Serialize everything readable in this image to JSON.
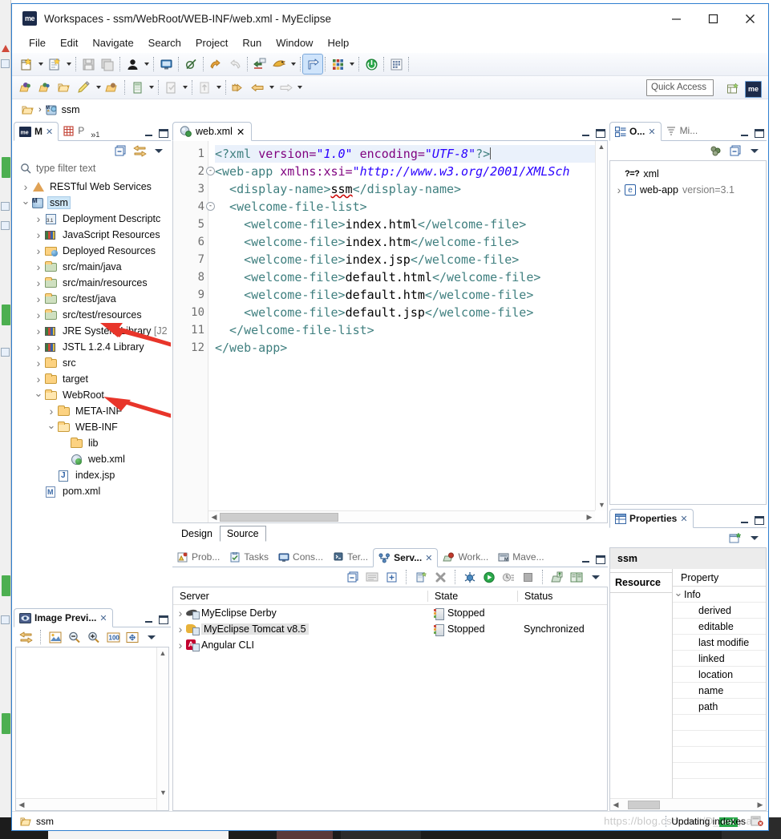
{
  "window": {
    "title": "Workspaces - ssm/WebRoot/WEB-INF/web.xml - MyEclipse",
    "logo_text": "me",
    "minimize": "—",
    "maximize": "☐",
    "close": "✕"
  },
  "menu": {
    "items": [
      {
        "label": "File"
      },
      {
        "label": "Edit"
      },
      {
        "label": "Navigate"
      },
      {
        "label": "Search"
      },
      {
        "label": "Project"
      },
      {
        "label": "Run"
      },
      {
        "label": "Window"
      },
      {
        "label": "Help"
      }
    ]
  },
  "toolbar": {
    "quick_access_placeholder": "Quick Access",
    "perspective_label": "me"
  },
  "breadcrumb": {
    "root_icon": "folder-icon",
    "separator": "›",
    "project": "ssm"
  },
  "explorer": {
    "tabs": [
      {
        "label": "M",
        "selected": true,
        "icon": "myeclipse-icon",
        "closeable": true
      },
      {
        "label": "P",
        "selected": false,
        "icon": "package-explorer-icon",
        "closeable": false
      },
      {
        "label": "»",
        "selected": false,
        "badge": "1",
        "icon": "chevron-more-icon"
      }
    ],
    "filter_placeholder": "type filter text",
    "tree": [
      {
        "label": "RESTful Web Services",
        "indent": 0,
        "twist": "closed",
        "icon": "rest-icon",
        "selected": false
      },
      {
        "label": "ssm",
        "indent": 0,
        "twist": "open",
        "icon": "project-icon",
        "selected": true
      },
      {
        "label": "Deployment Descriptc",
        "indent": 1,
        "twist": "closed",
        "icon": "deployment-descriptor-icon",
        "selected": false
      },
      {
        "label": "JavaScript Resources",
        "indent": 1,
        "twist": "closed",
        "icon": "library-icon",
        "selected": false
      },
      {
        "label": "Deployed Resources",
        "indent": 1,
        "twist": "closed",
        "icon": "deployed-resources-icon",
        "selected": false
      },
      {
        "label": "src/main/java",
        "indent": 1,
        "twist": "closed",
        "icon": "source-folder-icon",
        "selected": false
      },
      {
        "label": "src/main/resources",
        "indent": 1,
        "twist": "closed",
        "icon": "source-folder-icon",
        "selected": false
      },
      {
        "label": "src/test/java",
        "indent": 1,
        "twist": "closed",
        "icon": "source-folder-icon",
        "selected": false
      },
      {
        "label": "src/test/resources",
        "indent": 1,
        "twist": "closed",
        "icon": "source-folder-icon",
        "selected": false
      },
      {
        "label": "JRE System Library ",
        "dim": "[J2",
        "indent": 1,
        "twist": "closed",
        "icon": "library-icon",
        "selected": false
      },
      {
        "label": "JSTL 1.2.4 Library",
        "indent": 1,
        "twist": "closed",
        "icon": "library-icon",
        "selected": false
      },
      {
        "label": "src",
        "indent": 1,
        "twist": "closed",
        "icon": "folder-icon",
        "selected": false
      },
      {
        "label": "target",
        "indent": 1,
        "twist": "closed",
        "icon": "folder-icon",
        "selected": false
      },
      {
        "label": "WebRoot",
        "indent": 1,
        "twist": "open",
        "icon": "folder-open-icon",
        "selected": false
      },
      {
        "label": "META-INF",
        "indent": 2,
        "twist": "closed",
        "icon": "folder-icon",
        "selected": false
      },
      {
        "label": "WEB-INF",
        "indent": 2,
        "twist": "open",
        "icon": "folder-open-icon",
        "selected": false
      },
      {
        "label": "lib",
        "indent": 3,
        "twist": "none",
        "icon": "folder-icon",
        "selected": false
      },
      {
        "label": "web.xml",
        "indent": 3,
        "twist": "none",
        "icon": "xml-file-icon",
        "selected": false
      },
      {
        "label": "index.jsp",
        "indent": 2,
        "twist": "none",
        "icon": "jsp-file-icon",
        "selected": false
      },
      {
        "label": "pom.xml",
        "indent": 1,
        "twist": "none",
        "icon": "maven-pom-icon",
        "selected": false
      }
    ]
  },
  "editor": {
    "tab_label": "web.xml",
    "tab_icon": "xml-file-icon",
    "lines": [
      {
        "n": "1",
        "fold": "",
        "highlight": true,
        "segs": [
          {
            "t": "<?xml ",
            "c": "tag"
          },
          {
            "t": "version=",
            "c": "attr"
          },
          {
            "t": "\"1.0\"",
            "c": "val"
          },
          {
            "t": " ",
            "c": "txt"
          },
          {
            "t": "encoding=",
            "c": "attr"
          },
          {
            "t": "\"UTF-8\"",
            "c": "val"
          },
          {
            "t": "?>",
            "c": "tag"
          }
        ]
      },
      {
        "n": "2",
        "fold": "-",
        "highlight": false,
        "segs": [
          {
            "t": "<web-app ",
            "c": "tag"
          },
          {
            "t": "xmlns:xsi=",
            "c": "attr"
          },
          {
            "t": "\"http://www.w3.org/2001/XMLSch",
            "c": "val"
          }
        ]
      },
      {
        "n": "3",
        "fold": "",
        "highlight": false,
        "segs": [
          {
            "t": "  <display-name>",
            "c": "tag"
          },
          {
            "t": "ssm",
            "c": "misspell"
          },
          {
            "t": "</display-name>",
            "c": "tag"
          }
        ]
      },
      {
        "n": "4",
        "fold": "-",
        "highlight": false,
        "segs": [
          {
            "t": "  <welcome-file-list>",
            "c": "tag"
          }
        ]
      },
      {
        "n": "5",
        "fold": "",
        "highlight": false,
        "segs": [
          {
            "t": "    <welcome-file>",
            "c": "tag"
          },
          {
            "t": "index.html",
            "c": "txt"
          },
          {
            "t": "</welcome-file>",
            "c": "tag"
          }
        ]
      },
      {
        "n": "6",
        "fold": "",
        "highlight": false,
        "segs": [
          {
            "t": "    <welcome-file>",
            "c": "tag"
          },
          {
            "t": "index.htm",
            "c": "txt"
          },
          {
            "t": "</welcome-file>",
            "c": "tag"
          }
        ]
      },
      {
        "n": "7",
        "fold": "",
        "highlight": false,
        "segs": [
          {
            "t": "    <welcome-file>",
            "c": "tag"
          },
          {
            "t": "index.jsp",
            "c": "txt"
          },
          {
            "t": "</welcome-file>",
            "c": "tag"
          }
        ]
      },
      {
        "n": "8",
        "fold": "",
        "highlight": false,
        "segs": [
          {
            "t": "    <welcome-file>",
            "c": "tag"
          },
          {
            "t": "default.html",
            "c": "txt"
          },
          {
            "t": "</welcome-file>",
            "c": "tag"
          }
        ]
      },
      {
        "n": "9",
        "fold": "",
        "highlight": false,
        "segs": [
          {
            "t": "    <welcome-file>",
            "c": "tag"
          },
          {
            "t": "default.htm",
            "c": "txt"
          },
          {
            "t": "</welcome-file>",
            "c": "tag"
          }
        ]
      },
      {
        "n": "10",
        "fold": "",
        "highlight": false,
        "segs": [
          {
            "t": "    <welcome-file>",
            "c": "tag"
          },
          {
            "t": "default.jsp",
            "c": "txt"
          },
          {
            "t": "</welcome-file>",
            "c": "tag"
          }
        ]
      },
      {
        "n": "11",
        "fold": "",
        "highlight": false,
        "segs": [
          {
            "t": "  </welcome-file-list>",
            "c": "tag"
          }
        ]
      },
      {
        "n": "12",
        "fold": "",
        "highlight": false,
        "segs": [
          {
            "t": "</web-app>",
            "c": "tag"
          }
        ]
      }
    ],
    "bottom_tabs": [
      {
        "label": "Design",
        "selected": false
      },
      {
        "label": "Source",
        "selected": true
      }
    ]
  },
  "servers": {
    "tabs": [
      {
        "label": "Prob...",
        "icon": "problems-icon",
        "selected": false
      },
      {
        "label": "Tasks",
        "icon": "tasks-icon",
        "selected": false
      },
      {
        "label": "Cons...",
        "icon": "console-icon",
        "selected": false
      },
      {
        "label": "Ter...",
        "icon": "terminal-icon",
        "selected": false
      },
      {
        "label": "Serv...",
        "icon": "servers-icon",
        "selected": true
      },
      {
        "label": "Work...",
        "icon": "workspace-icon",
        "selected": false
      },
      {
        "label": "Mave...",
        "icon": "maven-icon",
        "selected": false
      }
    ],
    "columns": [
      "Server",
      "State",
      "Status"
    ],
    "rows": [
      {
        "name": "MyEclipse Derby",
        "icon": "derby-icon",
        "state": "Stopped",
        "status": "",
        "selected": false
      },
      {
        "name": "MyEclipse Tomcat v8.5",
        "icon": "tomcat-icon",
        "state": "Stopped",
        "status": "Synchronized",
        "selected": true
      },
      {
        "name": "Angular CLI",
        "icon": "angular-icon",
        "state": "",
        "status": "",
        "selected": false
      }
    ]
  },
  "image_preview": {
    "tab_label": "Image Previ...",
    "tab_icon": "image-preview-icon"
  },
  "outline": {
    "tabs": [
      {
        "label": "O...",
        "icon": "outline-icon",
        "selected": true
      },
      {
        "label": "Mi...",
        "icon": "miniature-icon",
        "selected": false
      }
    ],
    "rows": [
      {
        "label": "xml",
        "prefix": "?=?",
        "kind": "declaration",
        "twist": "none"
      },
      {
        "label": "web-app",
        "dim": "version=3.1",
        "kind": "element",
        "twist": "closed"
      }
    ]
  },
  "properties": {
    "tab_label": "Properties",
    "tab_icon": "properties-icon",
    "selected_object": "ssm",
    "side_tabs": [
      "Resource"
    ],
    "column_header": "Property",
    "rows": [
      {
        "label": "Info",
        "group": true,
        "twist": "open"
      },
      {
        "label": "derived",
        "group": false
      },
      {
        "label": "editable",
        "group": false
      },
      {
        "label": "last modifie",
        "group": false
      },
      {
        "label": "linked",
        "group": false
      },
      {
        "label": "location",
        "group": false
      },
      {
        "label": "name",
        "group": false
      },
      {
        "label": "path",
        "group": false
      }
    ]
  },
  "statusbar": {
    "project_icon": "project-icon",
    "project": "ssm",
    "task": "Updating indexes",
    "watermark": "https://blog.csdn.net/D_",
    "watermark_tail": "est",
    "watermark_end": "y a"
  },
  "colors": {
    "accent": "#2f7fd0",
    "tag": "#3f7f7f",
    "attr": "#7f007f",
    "value": "#2a00ff",
    "selection": "#cde6f7",
    "arrow_red": "#e8352a",
    "status_green": "#2aa84a"
  }
}
